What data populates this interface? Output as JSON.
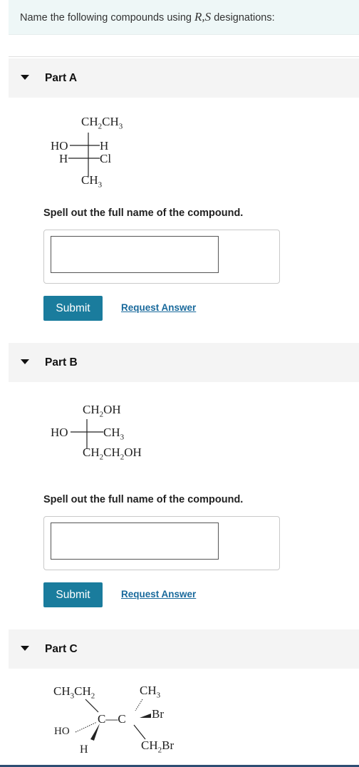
{
  "intro": {
    "text_before": "Name the following compounds using ",
    "rs_label": "R,S",
    "text_after": " designations:"
  },
  "parts": [
    {
      "title": "Part A",
      "structure": {
        "top": "CH2CH3",
        "left1": "HO",
        "right1": "H",
        "left2": "H",
        "right2": "Cl",
        "bottom": "CH3"
      },
      "instruction": "Spell out the full name of the compound.",
      "answer_value": "",
      "submit_label": "Submit",
      "request_label": "Request Answer"
    },
    {
      "title": "Part B",
      "structure": {
        "top": "CH2OH",
        "left": "HO",
        "right": "CH3",
        "bottom": "CH2CH2OH"
      },
      "instruction": "Spell out the full name of the compound.",
      "answer_value": "",
      "submit_label": "Submit",
      "request_label": "Request Answer"
    },
    {
      "title": "Part C",
      "structure": {
        "top_left": "CH3CH2",
        "top_right": "CH3",
        "center": "C—C",
        "right": "Br",
        "left": "HO",
        "bottom_left": "H",
        "bottom_right": "CH2Br"
      }
    }
  ]
}
